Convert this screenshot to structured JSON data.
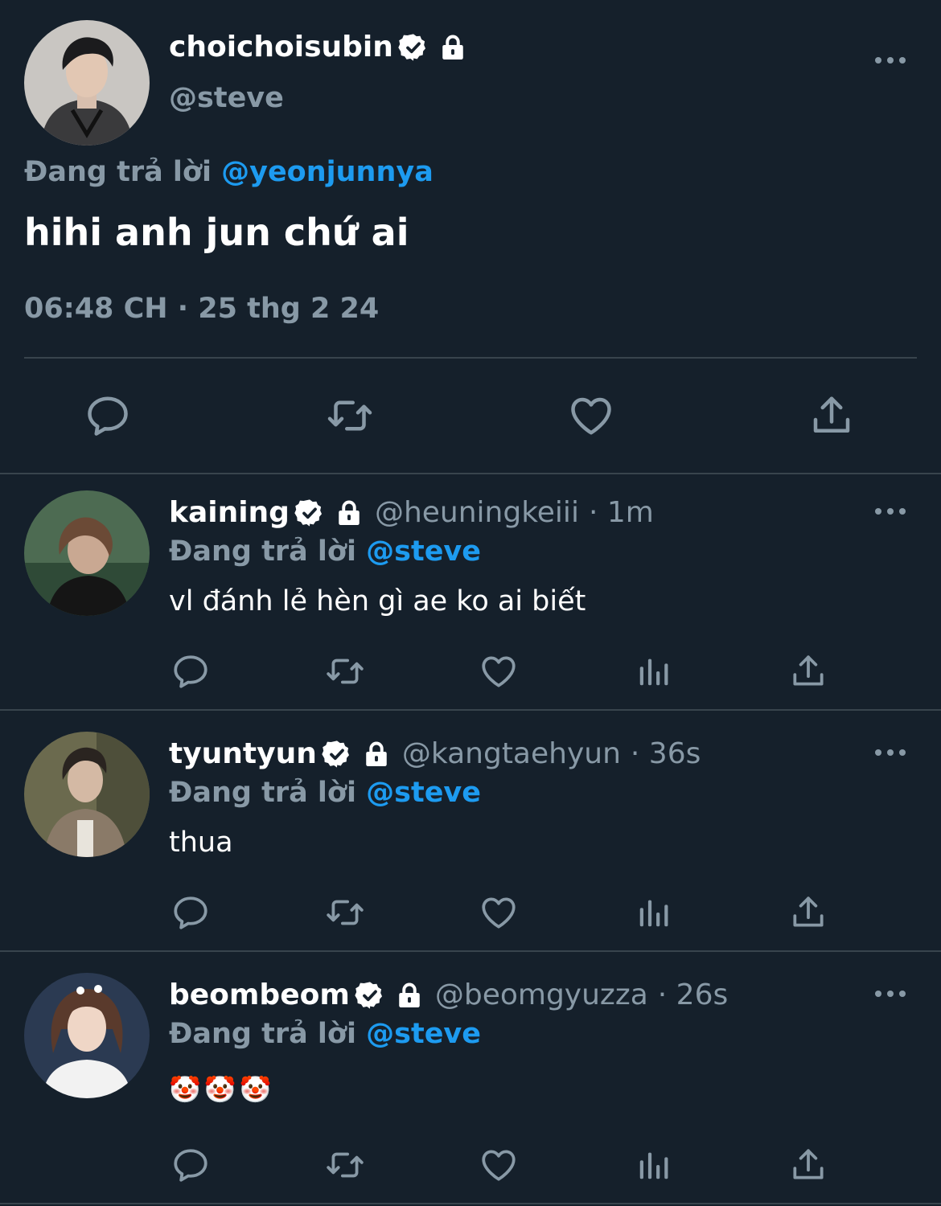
{
  "main_tweet": {
    "display_name": "choichoisubin",
    "handle": "@steve",
    "reply_prefix": "Đang trả lời",
    "reply_to": "@yeonjunnya",
    "text": "hihi anh jun chứ ai",
    "timestamp": "06:48 CH · 25 thg 2 24"
  },
  "replies": [
    {
      "display_name": "kaining",
      "handle": "@heuningkeiii",
      "time": "· 1m",
      "reply_prefix": "Đang trả lời",
      "reply_to": "@steve",
      "text": "vl đánh lẻ hèn gì ae ko ai biết"
    },
    {
      "display_name": "tyuntyun",
      "handle": "@kangtaehyun",
      "time": "· 36s",
      "reply_prefix": "Đang trả lời",
      "reply_to": "@steve",
      "text": "thua"
    },
    {
      "display_name": "beombeom",
      "handle": "@beomgyuzza",
      "time": "· 26s",
      "reply_prefix": "Đang trả lời",
      "reply_to": "@steve",
      "text": "🤡🤡🤡"
    }
  ],
  "icons": {
    "verified": "verified-badge-icon",
    "protected": "lock-icon",
    "more": "more-icon",
    "reply": "reply-icon",
    "retweet": "retweet-icon",
    "like": "heart-icon",
    "analytics": "analytics-icon",
    "share": "share-icon"
  },
  "colors": {
    "background": "#15202b",
    "muted": "#8899a6",
    "accent": "#1d9bf0",
    "divider": "#38444d"
  }
}
